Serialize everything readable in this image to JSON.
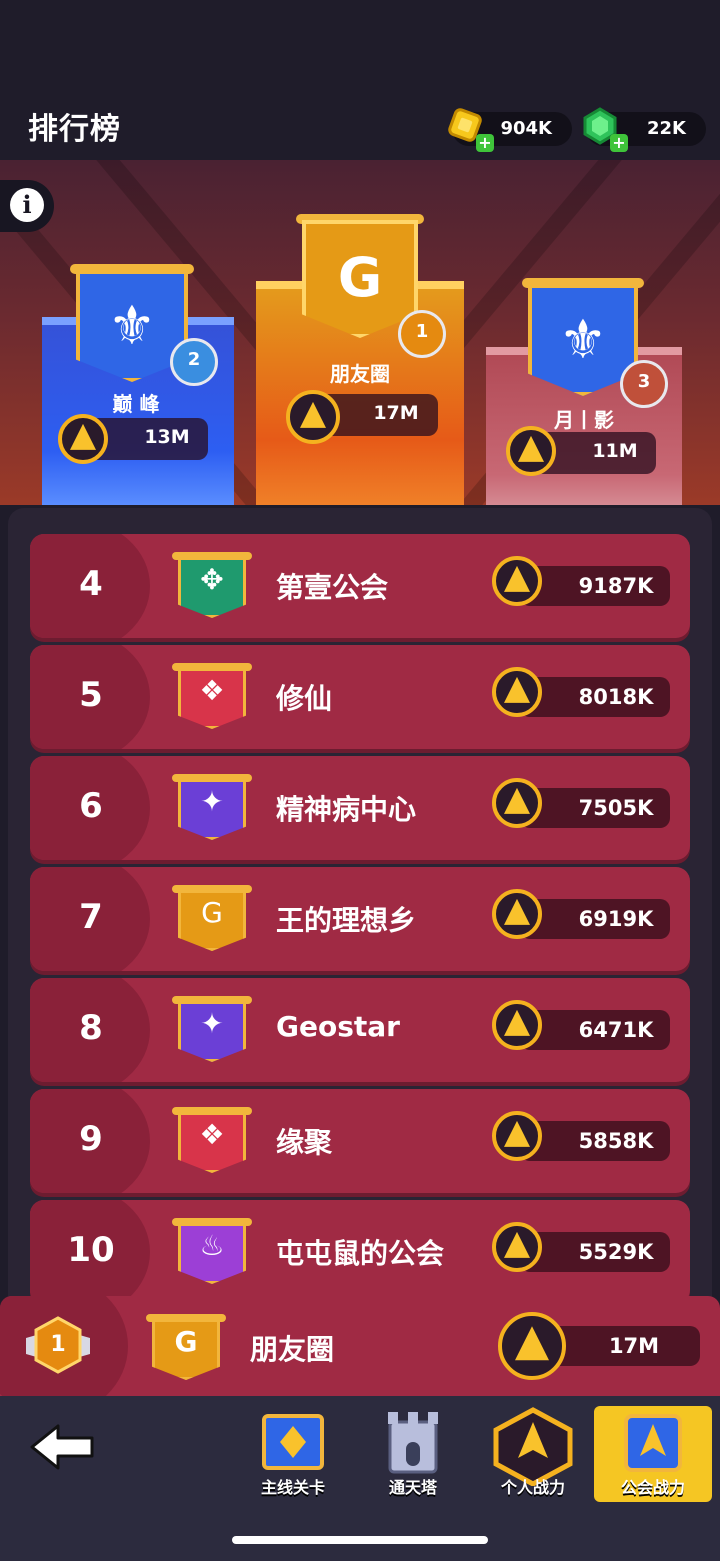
{
  "header": {
    "title": "排行榜",
    "gold": "904K",
    "gems": "22K"
  },
  "podium": [
    {
      "rank": "2",
      "name": "巅 峰",
      "power": "13M"
    },
    {
      "rank": "1",
      "name": "朋友圈",
      "power": "17M"
    },
    {
      "rank": "3",
      "name": "月丨影",
      "power": "11M"
    }
  ],
  "rows": [
    {
      "rank": "4",
      "name": "第壹公会",
      "power": "9187K",
      "color": "#1f9a6e",
      "emblem": "✥"
    },
    {
      "rank": "5",
      "name": "修仙",
      "power": "8018K",
      "color": "#d8344a",
      "emblem": "❖"
    },
    {
      "rank": "6",
      "name": "精神病中心",
      "power": "7505K",
      "color": "#6b3fd6",
      "emblem": "✦"
    },
    {
      "rank": "7",
      "name": "王的理想乡",
      "power": "6919K",
      "color": "#e59a16",
      "emblem": "G"
    },
    {
      "rank": "8",
      "name": "Geostar",
      "power": "6471K",
      "color": "#6b3fd6",
      "emblem": "✦"
    },
    {
      "rank": "9",
      "name": "缘聚",
      "power": "5858K",
      "color": "#d8344a",
      "emblem": "❖"
    },
    {
      "rank": "10",
      "name": "屯屯鼠的公会",
      "power": "5529K",
      "color": "#9c3fd6",
      "emblem": "♨"
    }
  ],
  "self": {
    "rank": "1",
    "name": "朋友圈",
    "power": "17M"
  },
  "nav": {
    "items": [
      {
        "label": "主线关卡"
      },
      {
        "label": "通天塔"
      },
      {
        "label": "个人战力"
      },
      {
        "label": "公会战力"
      }
    ]
  }
}
